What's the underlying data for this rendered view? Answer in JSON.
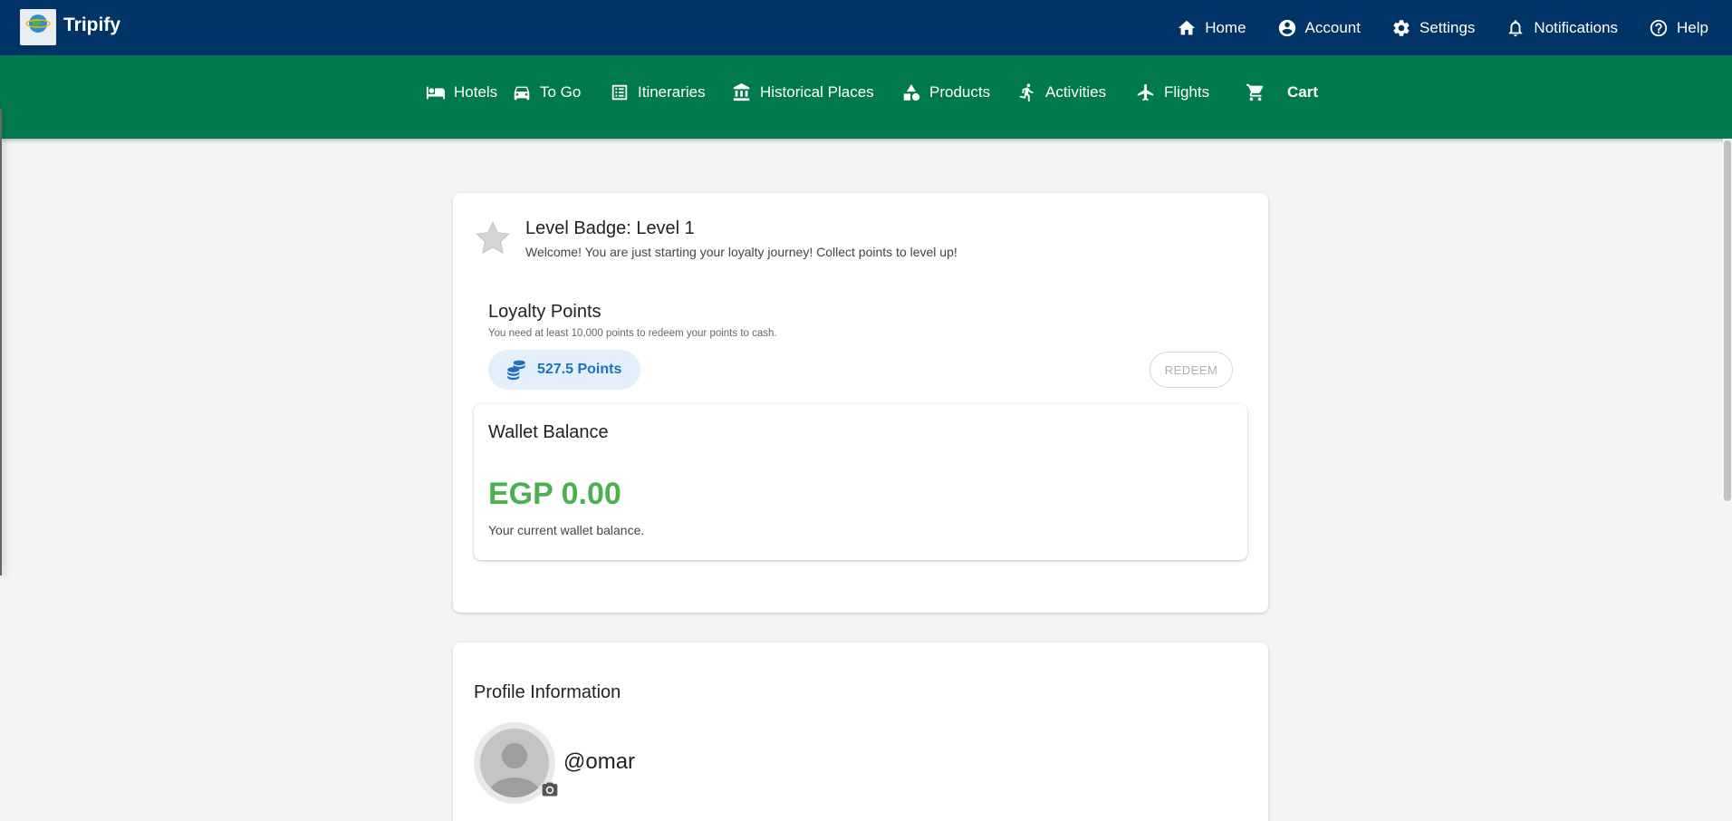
{
  "app": {
    "name": "Tripify",
    "logo_text": "TRIPIFY"
  },
  "top_nav": [
    {
      "label": "Home",
      "icon": "home-icon"
    },
    {
      "label": "Account",
      "icon": "account-circle-icon"
    },
    {
      "label": "Settings",
      "icon": "gear-icon"
    },
    {
      "label": "Notifications",
      "icon": "bell-icon"
    },
    {
      "label": "Help",
      "icon": "help-circle-icon"
    }
  ],
  "category_nav": [
    {
      "label": "Hotels",
      "icon": "bed-icon"
    },
    {
      "label": "To Go",
      "icon": "car-icon"
    },
    {
      "label": "Itineraries",
      "icon": "list-icon"
    },
    {
      "label": "Historical Places",
      "icon": "museum-icon"
    },
    {
      "label": "Products",
      "icon": "shapes-icon"
    },
    {
      "label": "Activities",
      "icon": "running-icon"
    },
    {
      "label": "Flights",
      "icon": "airplane-icon"
    },
    {
      "label": "Cart",
      "icon": "cart-icon"
    }
  ],
  "level_badge": {
    "title": "Level Badge: Level 1",
    "description": "Welcome! You are just starting your loyalty journey! Collect points to level up!"
  },
  "loyalty": {
    "title": "Loyalty Points",
    "note": "You need at least 10,000 points to redeem your points to cash.",
    "points_label": "527.5 Points",
    "redeem_label": "REDEEM"
  },
  "wallet": {
    "title": "Wallet Balance",
    "amount": "EGP 0.00",
    "description": "Your current wallet balance."
  },
  "profile": {
    "title": "Profile Information",
    "username": "@omar"
  },
  "colors": {
    "top_bar": "#003366",
    "category_bar": "#007a4d",
    "points_text": "#1f6fbf",
    "wallet_amount": "#4caf50"
  }
}
